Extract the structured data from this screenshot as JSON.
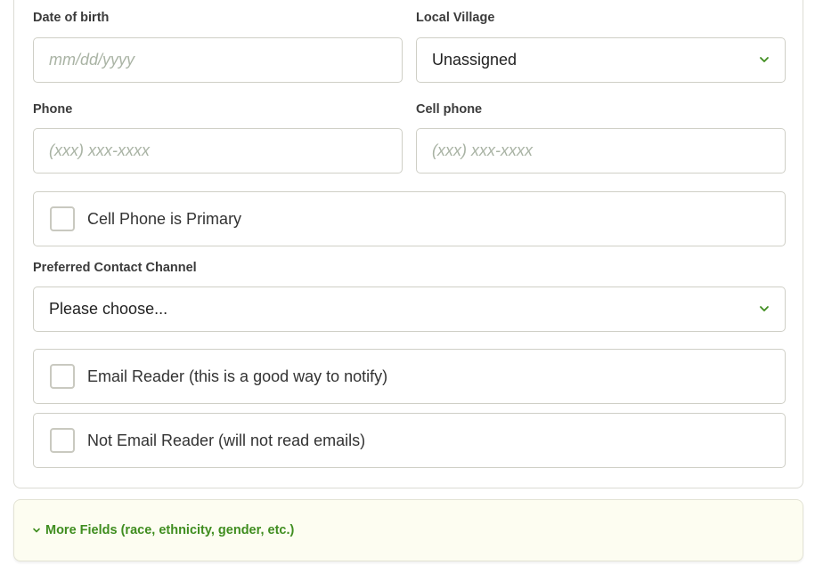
{
  "form": {
    "dob": {
      "label": "Date of birth",
      "placeholder": "mm/dd/yyyy",
      "value": ""
    },
    "village": {
      "label": "Local Village",
      "selected": "Unassigned"
    },
    "phone": {
      "label": "Phone",
      "placeholder": "(xxx) xxx-xxxx",
      "value": ""
    },
    "cell": {
      "label": "Cell phone",
      "placeholder": "(xxx) xxx-xxxx",
      "value": ""
    },
    "cell_primary": {
      "label": "Cell Phone is Primary",
      "checked": false
    },
    "contact_channel": {
      "label": "Preferred Contact Channel",
      "selected": "Please choose..."
    },
    "email_reader": {
      "label": "Email Reader (this is a good way to notify)",
      "checked": false
    },
    "not_email_reader": {
      "label": "Not Email Reader (will not read emails)",
      "checked": false
    }
  },
  "more_fields": {
    "label": "More Fields (race, ethnicity, gender, etc.)"
  },
  "colors": {
    "accent": "#3f8d1f",
    "border": "#cfcfc6",
    "more_bg": "#fdfdf1"
  },
  "icons": {
    "select": "chevron-down-icon",
    "more": "chevron-down-icon"
  }
}
